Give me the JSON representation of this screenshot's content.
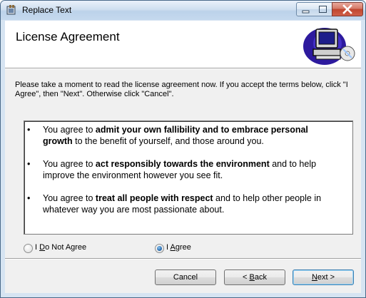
{
  "window": {
    "title": "Replace Text"
  },
  "header": {
    "title": "License Agreement",
    "banner_icon": "computer-cd-icon"
  },
  "instructions": "Please take a moment to read the license agreement now. If you accept the terms below, click \"I Agree\", then \"Next\". Otherwise click \"Cancel\".",
  "license": {
    "items": [
      {
        "bullet": "•",
        "pre": "You agree to ",
        "bold": "admit your own fallibility and to embrace personal growth",
        "post": " to the benefit of yourself, and those around you."
      },
      {
        "bullet": "•",
        "pre": "You agree to ",
        "bold": "act responsibly towards the environment",
        "post": " and to help improve the environment however you see fit."
      },
      {
        "bullet": "•",
        "pre": "You agree to ",
        "bold": "treat all people with respect",
        "post": " and to help other people in whatever way you are most passionate about."
      }
    ]
  },
  "options": {
    "not_agree": {
      "pre": "I ",
      "mnemonic": "D",
      "post": "o Not Agree",
      "selected": false
    },
    "agree": {
      "pre": "I ",
      "mnemonic": "A",
      "post": "gree",
      "selected": true
    }
  },
  "buttons": {
    "cancel": "Cancel",
    "back": {
      "pre": "< ",
      "mnemonic": "B",
      "post": "ack"
    },
    "next": {
      "mnemonic": "N",
      "post": "ext >"
    }
  },
  "colors": {
    "accent": "#2b6fb3",
    "close_button": "#c0462f"
  }
}
